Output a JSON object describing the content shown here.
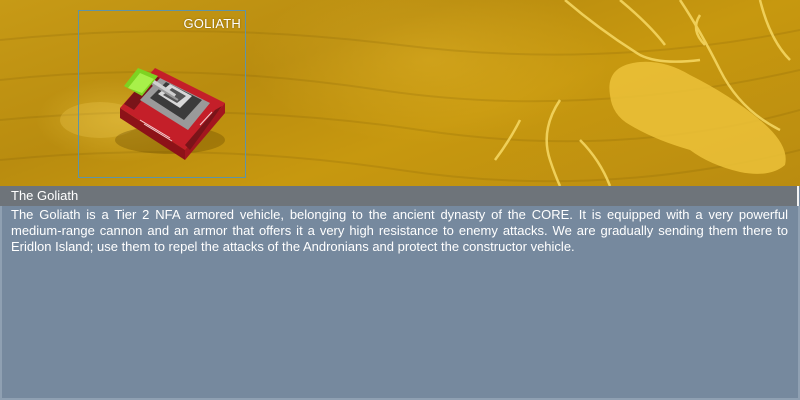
{
  "unit_frame": {
    "name": "GOLIATH"
  },
  "info_panel": {
    "title": "The Goliath",
    "description": "The Goliath is a Tier 2 NFA armored vehicle, belonging to the ancient dynasty of the CORE. It is equipped with a very powerful medium-range cannon and an armor that offers it a very high resistance to enemy attacks. We are gradually sending them there to Eridlon Island; use them to repel the attacks of the Andronians and protect the constructor vehicle."
  },
  "colors": {
    "sand": "#c79a16",
    "panel": "#76899e",
    "title_bar": "#6e747a",
    "frame_border": "#5f94a5",
    "vehicle_hull": "#c8202a",
    "vehicle_accent": "#7ed321"
  }
}
